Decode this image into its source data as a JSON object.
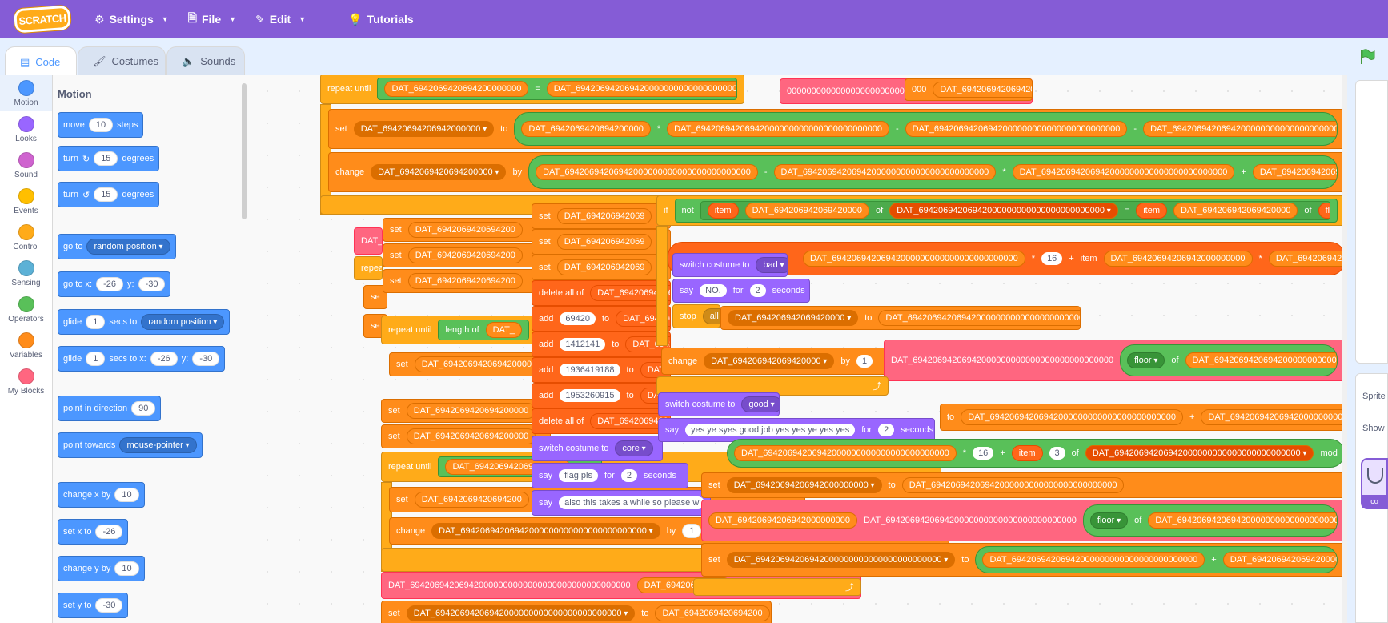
{
  "menubar": {
    "logo": "SCRATCH",
    "settings": "Settings",
    "file": "File",
    "edit": "Edit",
    "tutorials": "Tutorials"
  },
  "tabs": {
    "code": "Code",
    "costumes": "Costumes",
    "sounds": "Sounds"
  },
  "categories": [
    {
      "label": "Motion",
      "color": "#4c97ff"
    },
    {
      "label": "Looks",
      "color": "#9966ff"
    },
    {
      "label": "Sound",
      "color": "#cf63cf"
    },
    {
      "label": "Events",
      "color": "#ffbf00"
    },
    {
      "label": "Control",
      "color": "#ffab19"
    },
    {
      "label": "Sensing",
      "color": "#5cb1d6"
    },
    {
      "label": "Operators",
      "color": "#59c059"
    },
    {
      "label": "Variables",
      "color": "#ff8c1a"
    },
    {
      "label": "My Blocks",
      "color": "#ff6680"
    }
  ],
  "palette": {
    "title": "Motion",
    "move": "move",
    "move_val": "10",
    "steps": "steps",
    "turn": "turn",
    "turn_cw_val": "15",
    "turn_ccw_val": "15",
    "degrees": "degrees",
    "goto": "go to",
    "random_position": "random position",
    "gotoxy": "go to x:",
    "x_val": "-26",
    "y_label": "y:",
    "y_val": "-30",
    "glide": "glide",
    "glide_val": "1",
    "secs_to": "secs to",
    "secs_to_x": "secs to x:",
    "point_dir": "point in direction",
    "dir_val": "90",
    "point_towards": "point towards",
    "mouse_pointer": "mouse-pointer",
    "change_x": "change x by",
    "change_x_val": "10",
    "set_x": "set x to",
    "set_x_val": "-26",
    "change_y": "change y by",
    "change_y_val": "10",
    "set_y": "set y to",
    "set_y_val": "-30"
  },
  "script": {
    "repeat_until": "repeat until",
    "set": "set",
    "change": "change",
    "to": "to",
    "by": "by",
    "if": "if",
    "not": "not",
    "item": "item",
    "of": "of",
    "length_of": "length of",
    "add": "add",
    "delete_all_of": "delete all of",
    "switch_costume_to": "switch costume to",
    "say": "say",
    "for": "for",
    "seconds": "seconds",
    "stop": "stop",
    "all": "all",
    "floor": "floor",
    "mod": "mod",
    "v_short": "DAT_69420694206942000000",
    "v_mid": "DAT_6942069420694200000000",
    "v_long": "DAT_69420694206942000000000000000000000000",
    "v_xlong": "DAT_6942069420694200000000000000000000000000000",
    "v_tail": "DAT_69420694206942000000000000000000000000000",
    "frag_000": "000",
    "frag_zero_run": "0000000000000000000000000000000000000",
    "frag_dat": "DAT_",
    "frag_dat_cut": "DAT_6942069420694200",
    "frag_dat_cut2": "DAT_694206942069420",
    "frag_dat_cut3": "DAT_694206942069",
    "frag_dat_cut4": "DAT_6942069420694200000",
    "frag_dat_cut5": "DAT_694206942069420000",
    "frag_dat_cut6": "DAT_69420694206942000",
    "frag_dat_cut7": "DAT_69420694206942",
    "frag_dat_cut8": "DAT_69420694206942000000000000000000000000000",
    "frag_dat_cut9": "DAT_694206942069420000000000000000000000000",
    "frag_dat_cut10": "DAT_694206942069420000000000000000000000000000000",
    "frag_dat_short": "DAT_69420694206942000000000",
    "frag_tail_one": "1",
    "frag_repeat": "repeat",
    "frag_length_of_flag": "length of",
    "frag_flag": "flag",
    "frag_fla": "fla",
    "frag_d": "D",
    "frag_42": "42",
    "frag_00": "00",
    "frag_gt": ">",
    "frag_le": "le",
    "frag_se": "se",
    "frag_co": "co",
    "n16": "16",
    "n3": "3",
    "n2": "2",
    "n1": "1",
    "add1": "69420",
    "add2": "1412141",
    "add3": "1936419188",
    "add4": "1953260915",
    "costume_bad": "bad",
    "costume_good": "good",
    "costume_core": "core",
    "say_no": "NO.",
    "say_yes": "yes ye syes good job yes yes ye yes yes",
    "say_flag": "flag pls",
    "say_wait": "also this takes a while so please w",
    "op_eq": "=",
    "op_mul": "*",
    "op_sub": "-",
    "op_add": "+",
    "expr_num": "16"
  },
  "stage": {
    "sprite_label": "Sprite",
    "show_label": "Show",
    "costume_tag": "co"
  }
}
